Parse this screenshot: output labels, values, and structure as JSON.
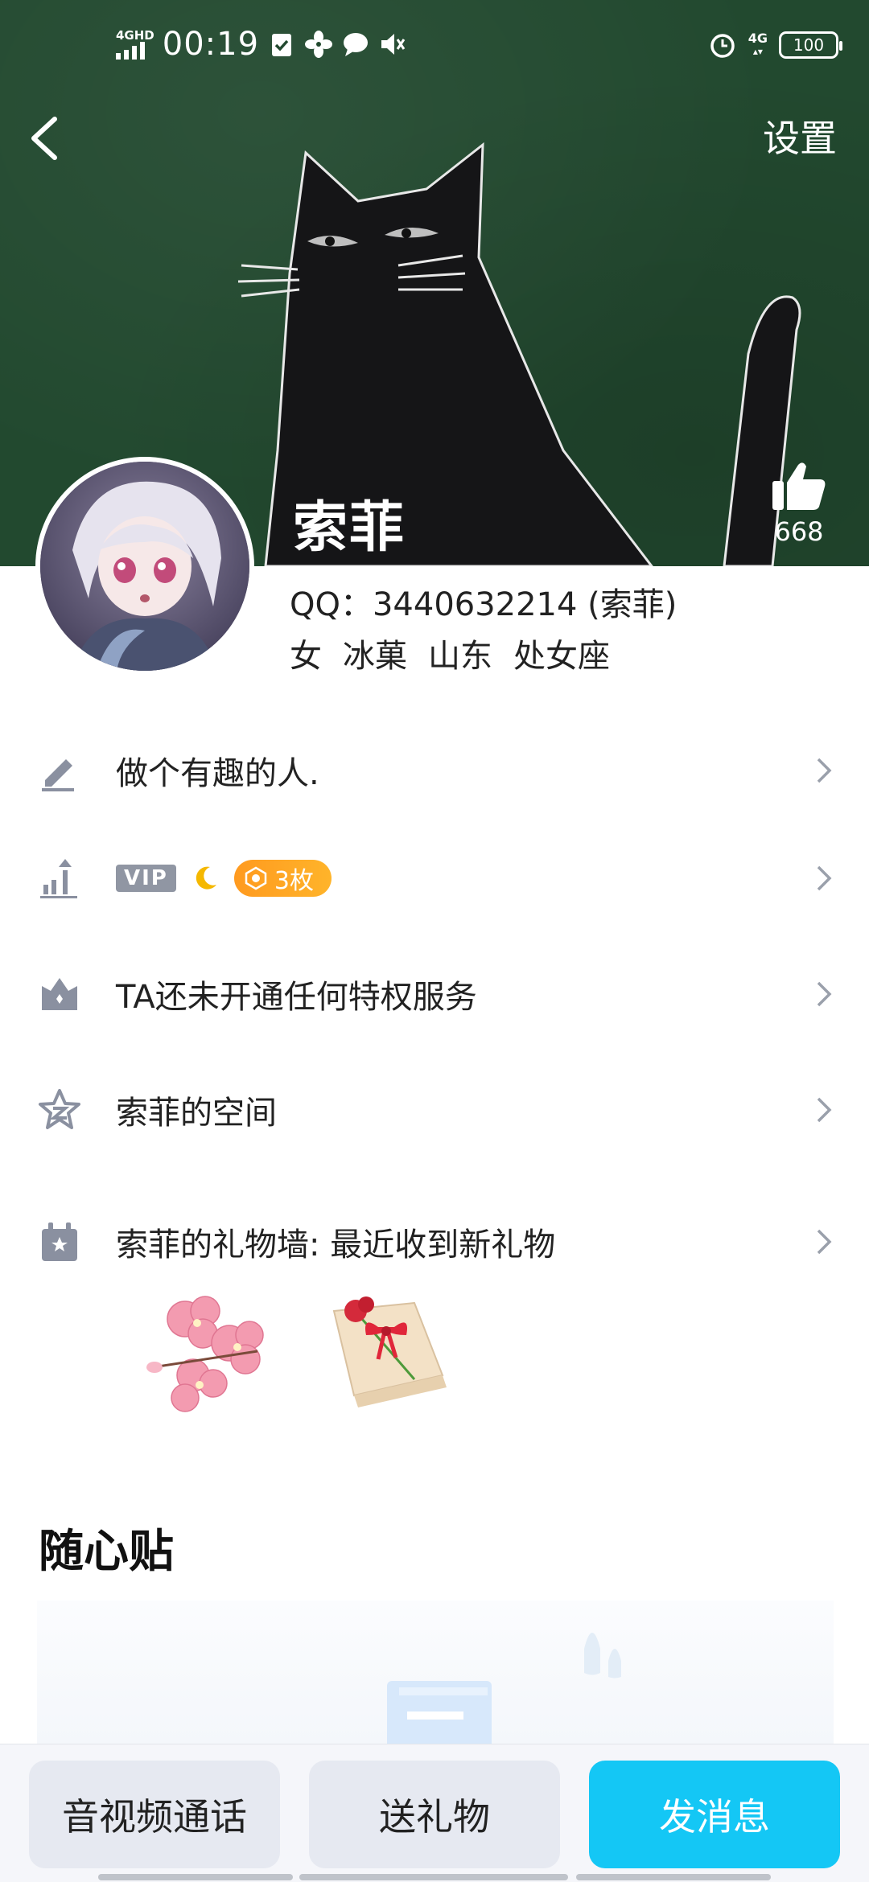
{
  "status_bar": {
    "network_label": "4GHD",
    "time": "00:19",
    "net_4g": "4G",
    "battery": "100"
  },
  "header": {
    "settings_label": "设置",
    "nickname": "索菲",
    "like_count": "668"
  },
  "profile": {
    "qq_line": "QQ：3440632214 (索菲)",
    "tags": [
      "女",
      "冰菓",
      "山东",
      "处女座"
    ]
  },
  "rows": {
    "signature": "做个有趣的人.",
    "vip_label": "VIP",
    "medal_count": "3枚",
    "privilege": "TA还未开通任何特权服务",
    "space": "索菲的空间",
    "gift_wall": "索菲的礼物墙: 最近收到新礼物"
  },
  "sections": {
    "suixin_title": "随心贴"
  },
  "bottom_bar": {
    "call_label": "音视频通话",
    "gift_label": "送礼物",
    "message_label": "发消息"
  },
  "colors": {
    "cover_green": "#22492f",
    "accent_blue": "#14c7f5",
    "medal_orange": "#ff9a1f",
    "icon_gray": "#8a90a0"
  },
  "icons": [
    "back-arrow-icon",
    "thumbs-up-icon",
    "pencil-icon",
    "level-chart-icon",
    "crown-icon",
    "qzone-star-icon",
    "gift-box-icon",
    "chevron-right-icon",
    "moon-icon",
    "medal-icon"
  ]
}
